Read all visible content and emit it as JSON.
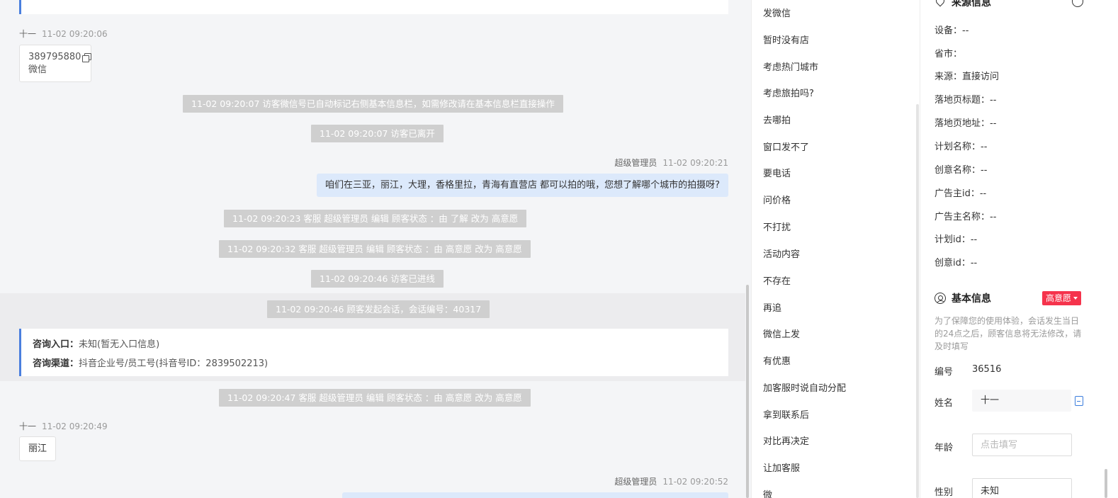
{
  "chat": {
    "m1": {
      "sender": "十一",
      "time": "11-02 09:20:06",
      "number": "389795880",
      "type": "微信"
    },
    "sys1": "11-02 09:20:07 访客微信号已自动标记右侧基本信息栏，如需修改请在基本信息栏直接操作",
    "sys2": "11-02 09:20:07 访客已离开",
    "m2": {
      "sender": "超级管理员",
      "time": "11-02 09:20:21",
      "text": "咱们在三亚，丽江，大理，香格里拉，青海有直营店 都可以拍的哦，您想了解哪个城市的拍摄呀?"
    },
    "sys3": "11-02 09:20:23 客服 超级管理员 编辑 顾客状态 ：由 了解 改为 高意愿",
    "sys4": "11-02 09:20:32 客服 超级管理员 编辑 顾客状态 ：由 高意愿 改为 高意愿",
    "sys5": "11-02 09:20:46 访客已进线",
    "sys6": "11-02 09:20:46 顾客发起会话，会话编号：40317",
    "entry": {
      "label": "咨询入口：",
      "value": "未知(暂无入口信息)",
      "channel_label": "咨询渠道：",
      "channel_value": "抖音企业号/员工号(抖音号ID：2839502213)"
    },
    "sys7": "11-02 09:20:47 客服 超级管理员 编辑 顾客状态 ：由 高意愿 改为 高意愿",
    "m3": {
      "sender": "十一",
      "time": "11-02 09:20:49",
      "text": "丽江"
    },
    "m4": {
      "sender": "超级管理员",
      "time": "11-02 09:20:52"
    }
  },
  "quick_replies": [
    "发微信",
    "暂时没有店",
    "考虑热门城市",
    "考虑旅拍吗?",
    "去哪拍",
    "窗口发不了",
    "要电话",
    "问价格",
    "不打扰",
    "活动内容",
    "不存在",
    "再追",
    "微信上发",
    "有优惠",
    "加客服时说自动分配",
    "拿到联系后",
    "对比再决定",
    "让加客服",
    "微"
  ],
  "source": {
    "title": "来源信息",
    "rows": [
      "设备：--",
      "省市：",
      "来源：直接访问",
      "落地页标题：--",
      "落地页地址：--",
      "计划名称：--",
      "创意名称：--",
      "广告主id：--",
      "广告主名称：--",
      "计划id：--",
      "创意id：--"
    ]
  },
  "basic": {
    "title": "基本信息",
    "intent": "高意愿",
    "intent_color": "#f5334c",
    "notice": "为了保障您的使用体验，会话发生当日的24点之后，顾客信息将无法修改，请及时填写",
    "id_label": "编号",
    "id_value": "36516",
    "name_label": "姓名",
    "name_value": "十一",
    "age_label": "年龄",
    "age_placeholder": "点击填写",
    "gender_label": "性别",
    "gender_value": "未知"
  },
  "colors": {
    "accent": "#4a7fde",
    "bubble_self": "#dce9fb",
    "system_msg": "#cfcfcf"
  }
}
